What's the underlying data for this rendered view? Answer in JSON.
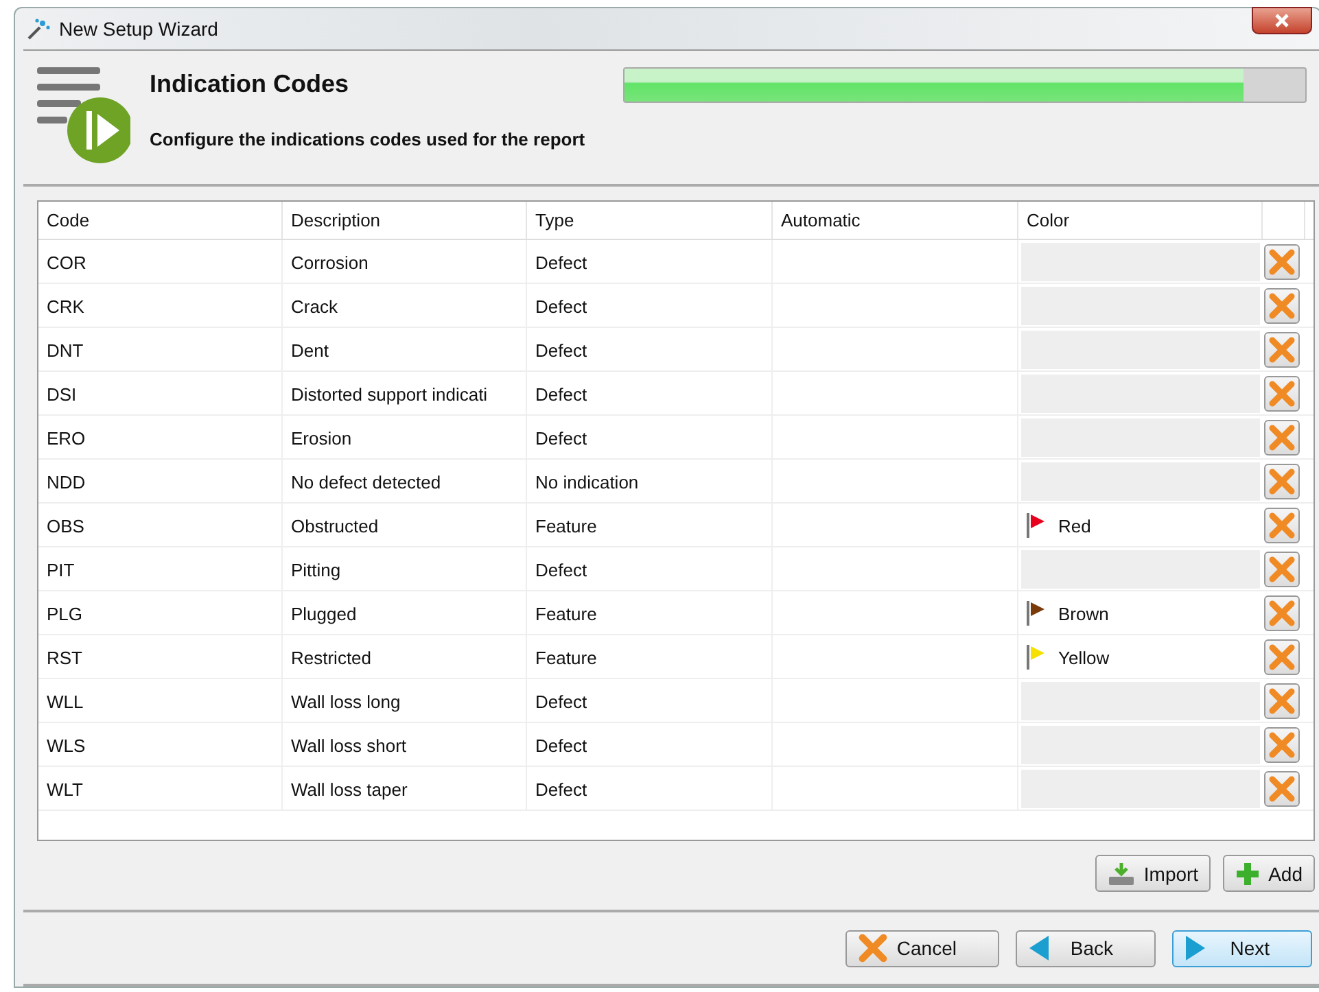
{
  "window": {
    "title": "New Setup Wizard"
  },
  "header": {
    "title": "Indication Codes",
    "subtitle": "Configure the indications codes used for the report",
    "progress": {
      "level": 0.91
    }
  },
  "table": {
    "columns": [
      "Code",
      "Description",
      "Type",
      "Automatic",
      "Color"
    ],
    "rows": [
      {
        "code": "COR",
        "description": "Corrosion",
        "type": "Defect"
      },
      {
        "code": "CRK",
        "description": "Crack",
        "type": "Defect"
      },
      {
        "code": "DNT",
        "description": "Dent",
        "type": "Defect"
      },
      {
        "code": "DSI",
        "description": "Distorted support indicati",
        "type": "Defect"
      },
      {
        "code": "ERO",
        "description": "Erosion",
        "type": "Defect"
      },
      {
        "code": "NDD",
        "description": "No defect detected",
        "type": "No indication"
      },
      {
        "code": "OBS",
        "description": "Obstructed",
        "type": "Feature",
        "color": "#e8001c",
        "color_name": "Red"
      },
      {
        "code": "PIT",
        "description": "Pitting",
        "type": "Defect"
      },
      {
        "code": "PLG",
        "description": "Plugged",
        "type": "Feature",
        "color": "#7a3a0a",
        "color_name": "Brown"
      },
      {
        "code": "RST",
        "description": "Restricted",
        "type": "Feature",
        "color": "#f5e000",
        "color_name": "Yellow"
      },
      {
        "code": "WLL",
        "description": "Wall loss long",
        "type": "Defect"
      },
      {
        "code": "WLS",
        "description": "Wall loss short",
        "type": "Defect"
      },
      {
        "code": "WLT",
        "description": "Wall loss taper",
        "type": "Defect"
      }
    ]
  },
  "table_actions": [
    {
      "kind": "import",
      "label": "Import"
    },
    {
      "kind": "add",
      "label": "Add"
    }
  ],
  "footer_buttons": [
    {
      "kind": "cancel",
      "label": "Cancel",
      "focused": false
    },
    {
      "kind": "back",
      "label": "Back",
      "focused": false
    },
    {
      "kind": "next",
      "label": "Next",
      "focused": true
    }
  ]
}
